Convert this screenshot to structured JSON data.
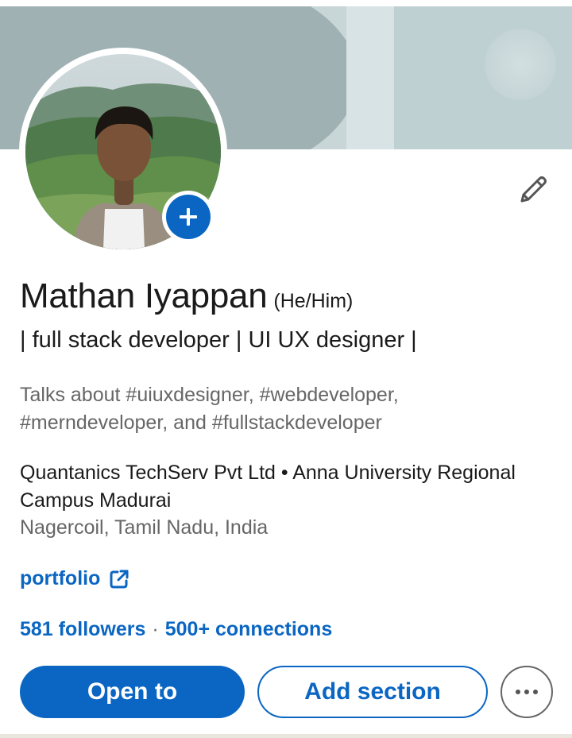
{
  "profile": {
    "name": "Mathan Iyappan",
    "pronouns": "(He/Him)",
    "headline": "| full stack developer | UI UX designer |",
    "talks_about": "Talks about #uiuxdesigner, #webdeveloper, #merndeveloper, and #fullstackdeveloper",
    "experience_education": "Quantanics TechServ Pvt Ltd • Anna University Regional Campus Madurai",
    "location": "Nagercoil, Tamil Nadu, India",
    "website_label": "portfolio"
  },
  "stats": {
    "followers": "581 followers",
    "separator": "·",
    "connections": "500+ connections"
  },
  "actions": {
    "open_to": "Open to",
    "add_section": "Add section"
  },
  "icons": {
    "add_photo": "plus-icon",
    "edit": "pencil-icon",
    "external": "external-link-icon",
    "more": "ellipsis-icon"
  },
  "colors": {
    "accent": "#0a66c2",
    "text_primary": "#1a1a1a",
    "text_secondary": "#666666",
    "banner": "#9fb1b3"
  }
}
